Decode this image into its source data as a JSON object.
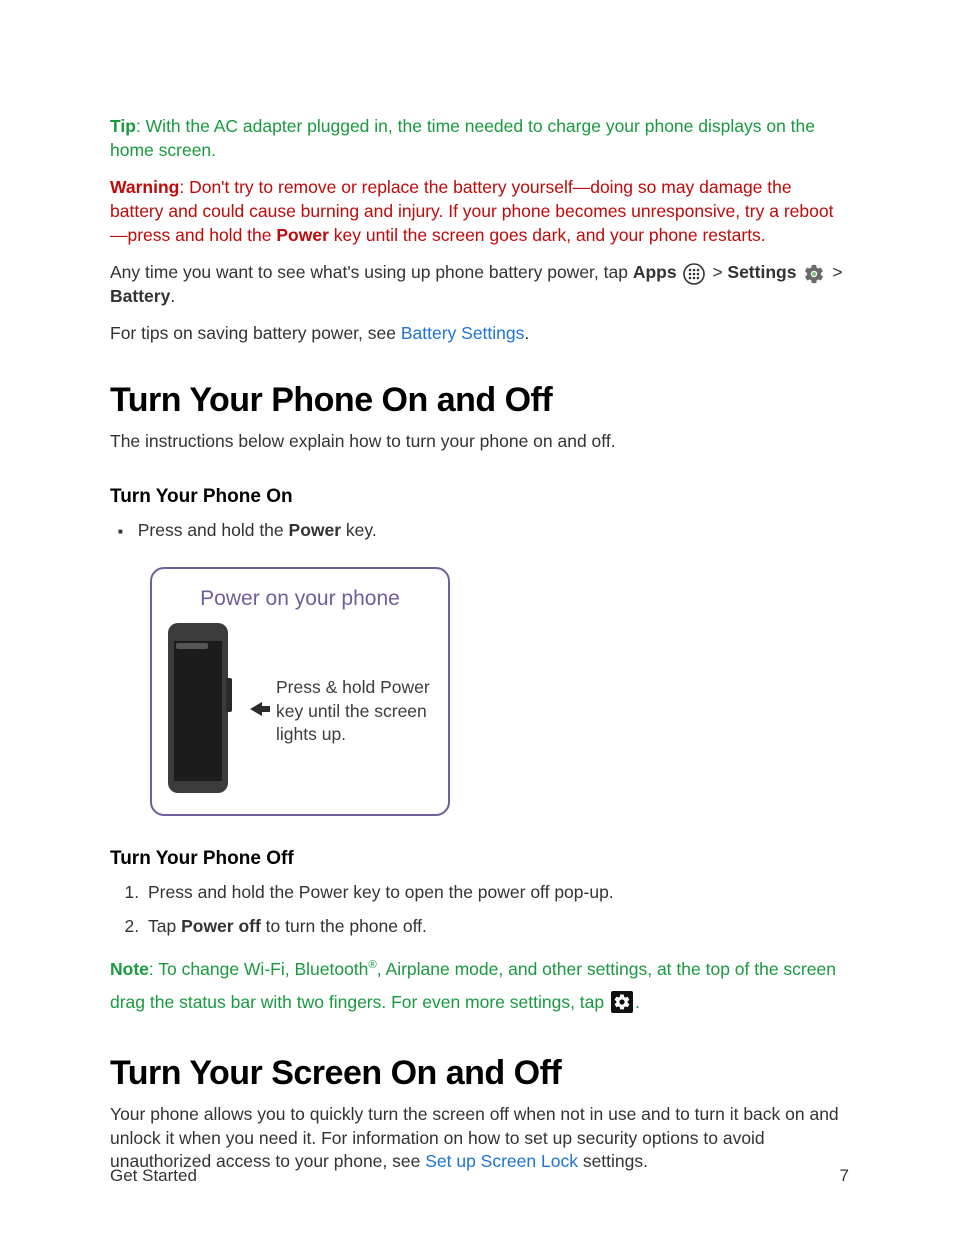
{
  "tip": {
    "label": "Tip",
    "text": ": With the AC adapter plugged in, the time needed to charge your phone displays on the home screen."
  },
  "warning": {
    "label": "Warning",
    "text1": ": Don't try to remove or replace the battery yourself—doing so may damage the battery and could cause burning and injury. If your phone becomes unresponsive, try a reboot—press and hold the ",
    "power": "Power",
    "text2": " key until the screen goes dark, and your phone restarts."
  },
  "battery_path": {
    "pre": "Any time you want to see what's using up phone battery power, tap ",
    "apps": "Apps",
    "settings": "Settings",
    "battery": "Battery",
    "gt": " > ",
    "period": "."
  },
  "tips_line": {
    "pre": "For tips on saving battery power, see ",
    "link": "Battery Settings",
    "post": "."
  },
  "h1a": "Turn Your Phone On and Off",
  "h1a_sub": "The instructions below explain how to turn your phone on and off.",
  "h2a": "Turn Your Phone On",
  "bullet": {
    "pre": "Press and hold the ",
    "power": "Power",
    "post": " key."
  },
  "figure": {
    "title": "Power on your phone",
    "caption": "Press & hold Power key until the screen lights up."
  },
  "h2b": "Turn Your Phone Off",
  "steps": {
    "s1": "Press and hold the Power key to open the power off pop-up.",
    "s2_pre": "Tap ",
    "s2_bold": "Power off",
    "s2_post": " to turn the phone off."
  },
  "note": {
    "label": "Note",
    "text1": ": To change Wi-Fi, Bluetooth",
    "reg": "®",
    "text2": ", Airplane mode, and other settings, at the top of the screen drag the status bar with two fingers. For even more settings, tap ",
    "post": "."
  },
  "h1b": "Turn Your Screen On and Off",
  "h1b_sub": {
    "pre": "Your phone allows you to quickly turn the screen off when not in use and to turn it back on and unlock it when you need it. For information on how to set up security options to avoid unauthorized access to your phone, see ",
    "link": "Set up Screen Lock",
    "post": " settings."
  },
  "footer": {
    "section": "Get Started",
    "page": "7"
  }
}
